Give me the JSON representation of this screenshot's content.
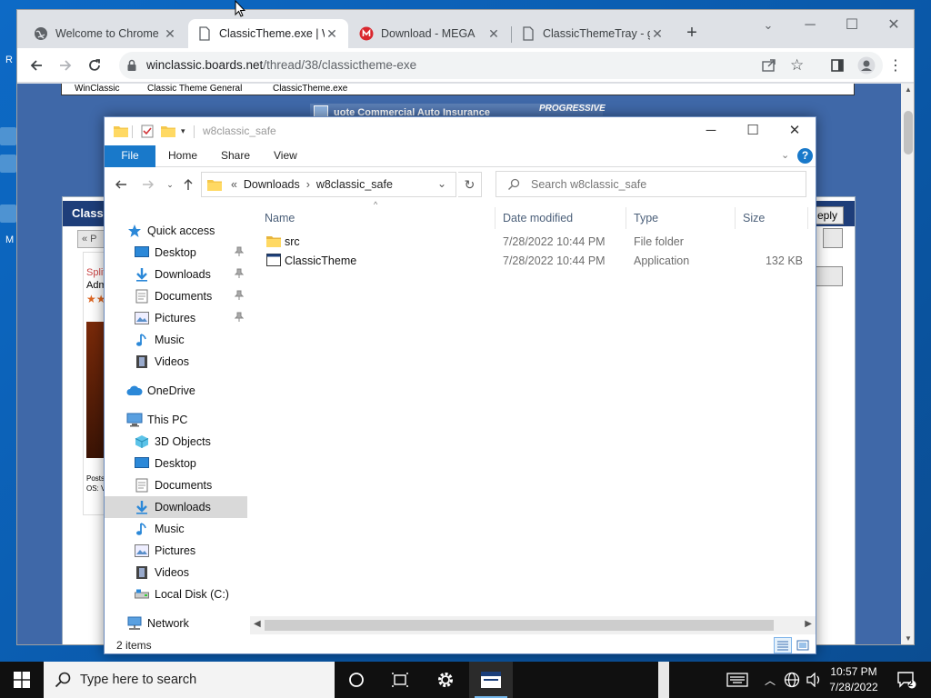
{
  "chrome": {
    "tabs": [
      {
        "label": "Welcome to Chrome",
        "icon": "globe-icon"
      },
      {
        "label": "ClassicTheme.exe | W",
        "icon": "page-icon"
      },
      {
        "label": "Download - MEGA",
        "icon": "mega-icon"
      },
      {
        "label": "ClassicThemeTray - g",
        "icon": "page-icon"
      }
    ],
    "url_host": "winclassic.boards.net",
    "url_path": "/thread/38/classictheme-exe"
  },
  "webpage": {
    "breadcrumb": [
      "WinClassic",
      "Classic Theme General",
      "ClassicTheme.exe"
    ],
    "ad_text": "uote Commercial Auto Insurance",
    "ad_brand": "PROGRESSIVE",
    "panel_title": "Classi",
    "reply_label": "eply",
    "pager_label": "« P",
    "author_name": "Split",
    "author_role": "Adm",
    "posts_label": "Posts",
    "os_label": "OS: V"
  },
  "explorer": {
    "title": "w8classic_safe",
    "ribbon_tabs": [
      "File",
      "Home",
      "Share",
      "View"
    ],
    "breadcrumb": [
      "Downloads",
      "w8classic_safe"
    ],
    "search_placeholder": "Search w8classic_safe",
    "nav": {
      "quick_access": "Quick access",
      "quick_items": [
        "Desktop",
        "Downloads",
        "Documents",
        "Pictures",
        "Music",
        "Videos"
      ],
      "onedrive": "OneDrive",
      "this_pc": "This PC",
      "pc_items": [
        "3D Objects",
        "Desktop",
        "Documents",
        "Downloads",
        "Music",
        "Pictures",
        "Videos",
        "Local Disk (C:)"
      ],
      "network": "Network"
    },
    "columns": [
      "Name",
      "Date modified",
      "Type",
      "Size"
    ],
    "files": [
      {
        "name": "src",
        "date": "7/28/2022 10:44 PM",
        "type": "File folder",
        "size": ""
      },
      {
        "name": "ClassicTheme",
        "date": "7/28/2022 10:44 PM",
        "type": "Application",
        "size": "132 KB"
      }
    ],
    "status": "2 items"
  },
  "taskbar": {
    "search_placeholder": "Type here to search",
    "time": "10:57 PM",
    "date": "7/28/2022",
    "notification_count": "2"
  },
  "colors": {
    "desktop": "#0a5fb4",
    "file_tab": "#1979ca",
    "selection": "#d9d9d9",
    "taskbar": "#101010"
  }
}
